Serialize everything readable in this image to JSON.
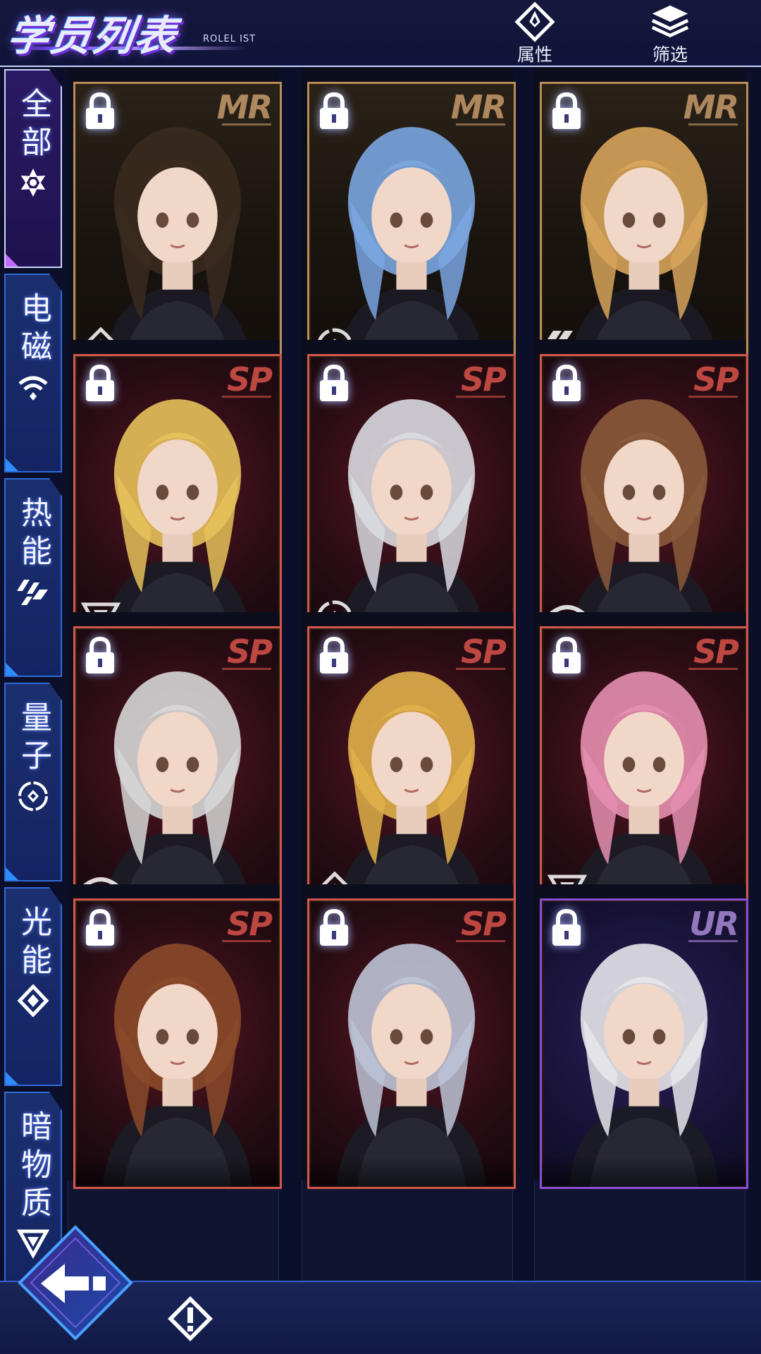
{
  "header": {
    "title": "学员列表",
    "subtitle": "ROLEL IST",
    "attribute_label": "属性",
    "filter_label": "筛选"
  },
  "sidebar": {
    "tabs": [
      {
        "label": "全部",
        "icon": "all-emblem-icon",
        "active": true
      },
      {
        "label": "电磁",
        "icon": "electromagnetic-wave-icon",
        "active": false
      },
      {
        "label": "热能",
        "icon": "thermal-slash-icon",
        "active": false
      },
      {
        "label": "量子",
        "icon": "quantum-ring-icon",
        "active": false
      },
      {
        "label": "光能",
        "icon": "light-diamond-icon",
        "active": false
      },
      {
        "label": "暗物质",
        "icon": "dark-matter-triangle-icon",
        "active": false
      }
    ]
  },
  "roster": {
    "cards": [
      {
        "rarity": "MR",
        "element": "light",
        "locked": true,
        "hair": "#3a2a1e"
      },
      {
        "rarity": "MR",
        "element": "quantum",
        "locked": true,
        "hair": "#7aa6e0"
      },
      {
        "rarity": "MR",
        "element": "thermal",
        "locked": true,
        "hair": "#d7a45a"
      },
      {
        "rarity": "SP",
        "element": "dark",
        "locked": true,
        "hair": "#e6c15a"
      },
      {
        "rarity": "SP",
        "element": "quantum",
        "locked": true,
        "hair": "#d9d9e0"
      },
      {
        "rarity": "SP",
        "element": "electromagnetic",
        "locked": true,
        "hair": "#8a5a3a"
      },
      {
        "rarity": "SP",
        "element": "electromagnetic",
        "locked": true,
        "hair": "#d6d6d6"
      },
      {
        "rarity": "SP",
        "element": "light",
        "locked": true,
        "hair": "#e0b04a"
      },
      {
        "rarity": "SP",
        "element": "dark",
        "locked": true,
        "hair": "#e58fb0"
      },
      {
        "rarity": "SP",
        "element": "",
        "locked": true,
        "hair": "#8a4a2a"
      },
      {
        "rarity": "SP",
        "element": "",
        "locked": true,
        "hair": "#bcc3d6"
      },
      {
        "rarity": "UR",
        "element": "",
        "locked": true,
        "hair": "#e6e6ea"
      }
    ]
  },
  "colors": {
    "header_bg": "#15183c",
    "accent_blue": "#2f6bd8",
    "accent_purple": "#7a48ff",
    "mr_border": "#c08a52",
    "sp_border": "#d3574a",
    "ur_border": "#8a4fd6"
  },
  "bottom_bar": {
    "back_icon": "back-arrow-icon",
    "info_icon": "exclamation-diamond-icon"
  }
}
